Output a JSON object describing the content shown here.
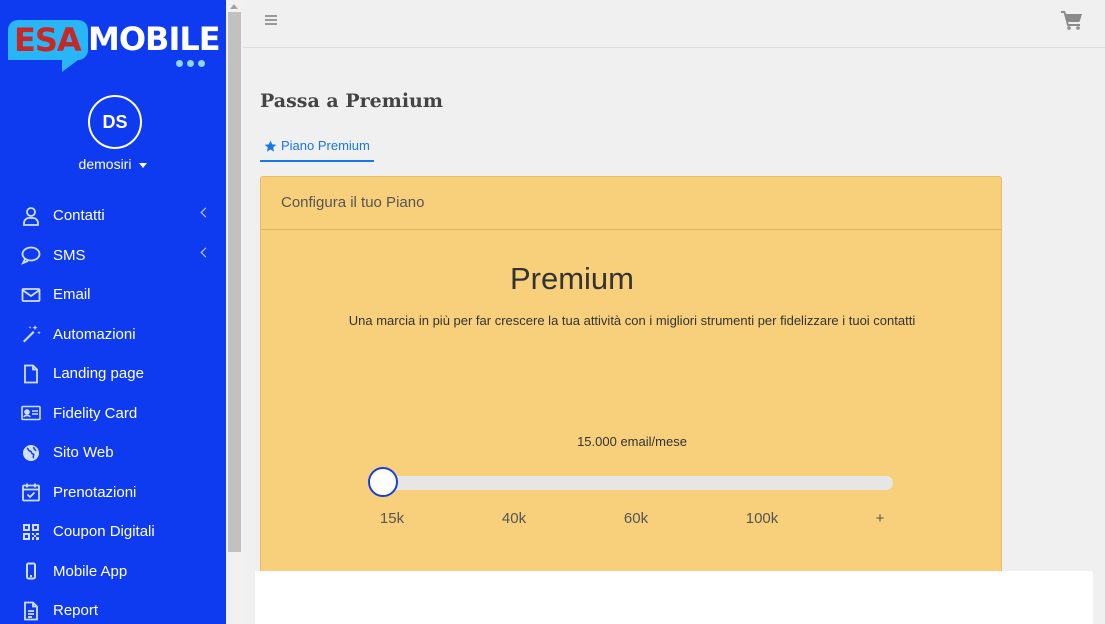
{
  "brand": {
    "part1": "ESA",
    "part2": "MOBILE"
  },
  "user": {
    "initials": "DS",
    "name": "demosiri"
  },
  "sidebar": {
    "items": [
      {
        "label": "Contatti",
        "icon": "user-icon",
        "has_submenu": true
      },
      {
        "label": "SMS",
        "icon": "speech-bubble-icon",
        "has_submenu": true
      },
      {
        "label": "Email",
        "icon": "envelope-icon",
        "has_submenu": false
      },
      {
        "label": "Automazioni",
        "icon": "magic-wand-icon",
        "has_submenu": false
      },
      {
        "label": "Landing page",
        "icon": "file-icon",
        "has_submenu": false
      },
      {
        "label": "Fidelity Card",
        "icon": "id-card-icon",
        "has_submenu": false
      },
      {
        "label": "Sito Web",
        "icon": "globe-icon",
        "has_submenu": false
      },
      {
        "label": "Prenotazioni",
        "icon": "calendar-check-icon",
        "has_submenu": false
      },
      {
        "label": "Coupon Digitali",
        "icon": "qrcode-icon",
        "has_submenu": false
      },
      {
        "label": "Mobile App",
        "icon": "mobile-phone-icon",
        "has_submenu": false
      },
      {
        "label": "Report",
        "icon": "report-file-icon",
        "has_submenu": false
      }
    ]
  },
  "page": {
    "title": "Passa a Premium",
    "tab_label": "Piano Premium"
  },
  "card": {
    "header": "Configura il tuo Piano",
    "plan_name": "Premium",
    "plan_description": "Una marcia in più per far crescere la tua attività con i migliori strumenti per fidelizzare i tuoi contatti",
    "slider": {
      "value_label": "15.000 email/mese",
      "ticks": [
        "15k",
        "40k",
        "60k",
        "100k",
        "+"
      ],
      "selected_index": 0
    }
  },
  "colors": {
    "sidebar_bg": "#0f3bf0",
    "card_bg": "#f8d07b",
    "accent": "#1677e6"
  }
}
